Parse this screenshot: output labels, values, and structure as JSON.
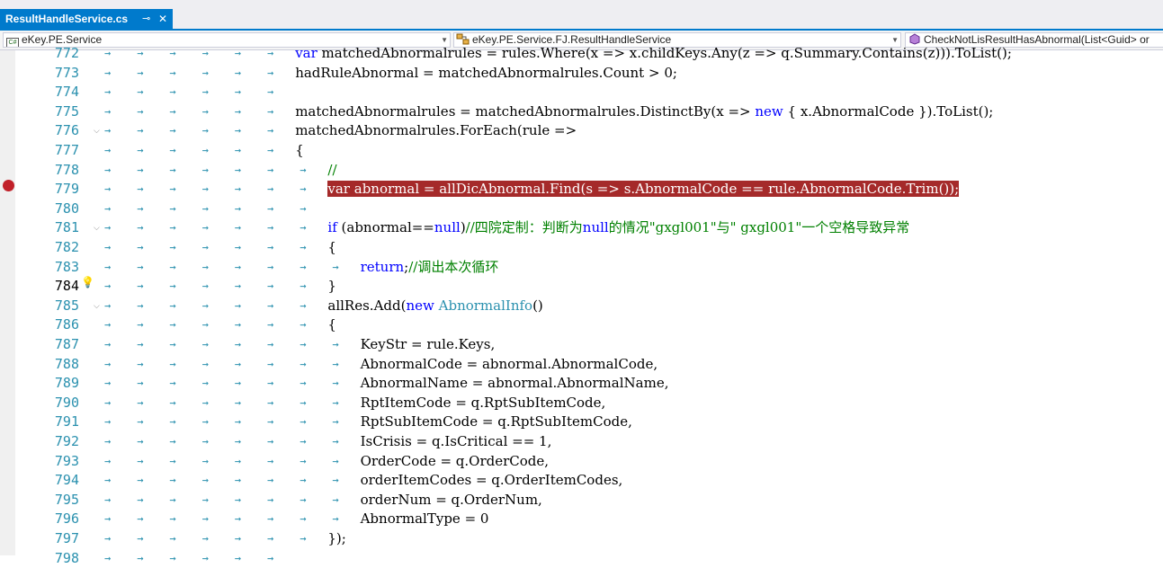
{
  "tab": {
    "title": "ResultHandleService.cs",
    "pin": "⊸",
    "close": "✕"
  },
  "nav": {
    "project": "eKey.PE.Service",
    "class": "eKey.PE.Service.FJ.ResultHandleService",
    "member": "CheckNotLisResultHasAbnormal(List<Guid> or",
    "project_icon": "C#",
    "class_icon": "class-icon",
    "member_icon": "method-icon"
  },
  "colors": {
    "accent": "#007acc",
    "breakpoint": "#c12029",
    "highlight": "#a52a2a",
    "line_number": "#2b91af"
  },
  "lines": [
    {
      "num": "772",
      "indent": 6,
      "text": "var matchedAbnormalrules = rules.Where(x => x.childKeys.Any(z => q.Summary.Contains(z))).ToList();"
    },
    {
      "num": "773",
      "indent": 6,
      "text": "hadRuleAbnormal = matchedAbnormalrules.Count > 0;"
    },
    {
      "num": "774",
      "indent": 6,
      "text": ""
    },
    {
      "num": "775",
      "indent": 6,
      "text": "matchedAbnormalrules = matchedAbnormalrules.DistinctBy(x => new { x.AbnormalCode }).ToList();"
    },
    {
      "num": "776",
      "indent": 6,
      "text": "matchedAbnormalrules.ForEach(rule =>",
      "fold": true
    },
    {
      "num": "777",
      "indent": 6,
      "text": "{"
    },
    {
      "num": "778",
      "indent": 7,
      "text": "//"
    },
    {
      "num": "779",
      "indent": 7,
      "text": "var abnormal = allDicAbnormal.Find(s => s.AbnormalCode == rule.AbnormalCode.Trim());",
      "highlight": true,
      "breakpoint": true
    },
    {
      "num": "780",
      "indent": 7,
      "text": ""
    },
    {
      "num": "781",
      "indent": 7,
      "text": "if (abnormal==null)//四院定制：判断为null的情况\"gxgl001\"与\" gxgl001\"一个空格导致异常",
      "fold": true
    },
    {
      "num": "782",
      "indent": 7,
      "text": "{"
    },
    {
      "num": "783",
      "indent": 8,
      "text": "return;//调出本次循环"
    },
    {
      "num": "784",
      "indent": 7,
      "text": "}",
      "current": true
    },
    {
      "num": "785",
      "indent": 7,
      "text": "allRes.Add(new AbnormalInfo()",
      "fold": true
    },
    {
      "num": "786",
      "indent": 7,
      "text": "{"
    },
    {
      "num": "787",
      "indent": 8,
      "text": "KeyStr = rule.Keys,"
    },
    {
      "num": "788",
      "indent": 8,
      "text": "AbnormalCode = abnormal.AbnormalCode,"
    },
    {
      "num": "789",
      "indent": 8,
      "text": "AbnormalName = abnormal.AbnormalName,"
    },
    {
      "num": "790",
      "indent": 8,
      "text": "RptItemCode = q.RptSubItemCode,"
    },
    {
      "num": "791",
      "indent": 8,
      "text": "RptSubItemCode = q.RptSubItemCode,"
    },
    {
      "num": "792",
      "indent": 8,
      "text": "IsCrisis = q.IsCritical == 1,"
    },
    {
      "num": "793",
      "indent": 8,
      "text": "OrderCode = q.OrderCode,"
    },
    {
      "num": "794",
      "indent": 8,
      "text": "orderItemCodes = q.OrderItemCodes,"
    },
    {
      "num": "795",
      "indent": 8,
      "text": "orderNum = q.OrderNum,"
    },
    {
      "num": "796",
      "indent": 8,
      "text": "AbnormalType = 0"
    },
    {
      "num": "797",
      "indent": 7,
      "text": "});"
    },
    {
      "num": "798",
      "indent": 6,
      "text": ""
    }
  ]
}
